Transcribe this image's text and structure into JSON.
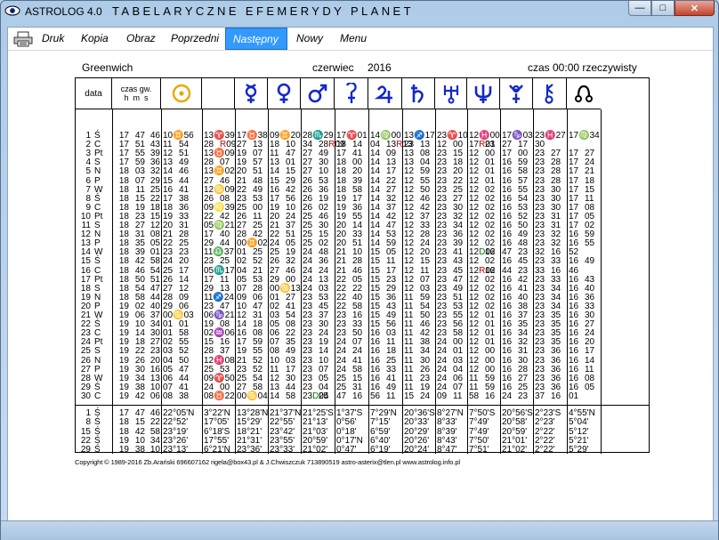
{
  "window": {
    "app_title": "ASTROLOG 4.0",
    "subtitle": "TABELARYCZNE EFEMERYDY PLANET",
    "min_glyph": "—",
    "max_glyph": "□",
    "close_glyph": "✕"
  },
  "menu": [
    "Druk",
    "Kopia",
    "Obraz",
    "Poprzedni",
    "Następny",
    "Nowy",
    "Menu"
  ],
  "menu_active": "Następny",
  "header": {
    "location": "Greenwich",
    "month": "czerwiec",
    "year": "2016",
    "time_note": "czas 00:00 rzeczywisty",
    "col_date": "data",
    "col_time_l1": "czas gw.",
    "col_time_l2": "h  m  s"
  },
  "planet_icons": [
    "sun-icon",
    "moon-icon",
    "mercury-icon",
    "venus-icon",
    "mars-icon",
    "ceres-icon",
    "jupiter-icon",
    "saturn-icon",
    "uranus-icon",
    "neptune-icon",
    "pluto-icon",
    "chiron-icon",
    "node-icon"
  ],
  "colors": {
    "accent_gold": "#e8a800",
    "moon_gold": "#f0b400",
    "planet_blue": "#1428c8",
    "retro_red": "#d00000",
    "direct_green": "#008000",
    "menu_active": "#3399ff"
  },
  "rows": [
    [
      "1",
      "Ś",
      "17",
      "47",
      "46",
      "10♊56",
      "13♈39",
      "17♉38",
      "09♊20",
      "28♏29",
      "17♈01",
      "14♍00",
      "13♐17",
      "23♈10",
      "12♓00",
      "17♑03",
      "23♓27",
      "17♍34"
    ],
    [
      "2",
      "C",
      "17",
      "51",
      "43",
      "11",
      "54",
      "28",
      "R 09",
      "27",
      "13",
      "18",
      "10",
      "34",
      "28R 09",
      "18",
      "14",
      "04",
      "13R 13",
      "23",
      "13",
      "12",
      "00",
      "17R 01",
      "23",
      "27",
      "17",
      "30"
    ],
    [
      "3",
      "Pt",
      "17",
      "55",
      "39",
      "12",
      "51",
      "13♉09",
      "19",
      "07",
      "11",
      "47",
      "27",
      "49",
      "17",
      "41",
      "14",
      "09",
      "13",
      "08",
      "23",
      "15",
      "12",
      "00",
      "17",
      "00",
      "23",
      "27",
      "17",
      "27"
    ],
    [
      "4",
      "S",
      "17",
      "59",
      "36",
      "13",
      "49",
      "28",
      "07",
      "19",
      "57",
      "13",
      "01",
      "27",
      "30",
      "18",
      "00",
      "14",
      "13",
      "13",
      "04",
      "23",
      "18",
      "12",
      "01",
      "16",
      "59",
      "23",
      "28",
      "17",
      "24"
    ],
    [
      "5",
      "N",
      "18",
      "03",
      "32",
      "14",
      "46",
      "13♊02",
      "20",
      "51",
      "14",
      "15",
      "27",
      "10",
      "18",
      "20",
      "14",
      "17",
      "12",
      "59",
      "23",
      "20",
      "12",
      "01",
      "16",
      "58",
      "23",
      "28",
      "17",
      "21"
    ],
    [
      "6",
      "P",
      "18",
      "07",
      "29",
      "15",
      "44",
      "27",
      "46",
      "21",
      "48",
      "15",
      "29",
      "26",
      "53",
      "18",
      "39",
      "14",
      "22",
      "12",
      "55",
      "23",
      "22",
      "12",
      "01",
      "16",
      "57",
      "23",
      "28",
      "17",
      "18"
    ],
    [
      "7",
      "W",
      "18",
      "11",
      "25",
      "16",
      "41",
      "12♋09",
      "22",
      "49",
      "16",
      "42",
      "26",
      "36",
      "18",
      "58",
      "14",
      "27",
      "12",
      "50",
      "23",
      "25",
      "12",
      "02",
      "16",
      "55",
      "23",
      "30",
      "17",
      "15"
    ],
    [
      "8",
      "Ś",
      "18",
      "15",
      "22",
      "17",
      "38",
      "26",
      "08",
      "23",
      "53",
      "17",
      "56",
      "26",
      "19",
      "19",
      "17",
      "14",
      "32",
      "12",
      "46",
      "23",
      "27",
      "12",
      "02",
      "16",
      "54",
      "23",
      "30",
      "17",
      "11"
    ],
    [
      "9",
      "C",
      "18",
      "19",
      "18",
      "18",
      "36",
      "09♌39",
      "25",
      "00",
      "19",
      "10",
      "26",
      "02",
      "19",
      "36",
      "14",
      "37",
      "12",
      "42",
      "23",
      "30",
      "12",
      "02",
      "16",
      "53",
      "23",
      "30",
      "17",
      "08"
    ],
    [
      "10",
      "Pt",
      "18",
      "23",
      "15",
      "19",
      "33",
      "22",
      "42",
      "26",
      "11",
      "20",
      "24",
      "25",
      "46",
      "19",
      "55",
      "14",
      "42",
      "12",
      "37",
      "23",
      "32",
      "12",
      "02",
      "16",
      "52",
      "23",
      "31",
      "17",
      "05"
    ],
    [
      "11",
      "S",
      "18",
      "27",
      "12",
      "20",
      "31",
      "05♍21",
      "27",
      "25",
      "21",
      "37",
      "25",
      "30",
      "20",
      "14",
      "14",
      "47",
      "12",
      "33",
      "23",
      "34",
      "12",
      "02",
      "16",
      "50",
      "23",
      "31",
      "17",
      "02"
    ],
    [
      "12",
      "N",
      "18",
      "31",
      "08",
      "21",
      "28",
      "17",
      "40",
      "28",
      "42",
      "22",
      "51",
      "25",
      "15",
      "20",
      "33",
      "14",
      "53",
      "12",
      "28",
      "23",
      "36",
      "12",
      "02",
      "16",
      "49",
      "23",
      "32",
      "16",
      "59"
    ],
    [
      "13",
      "P",
      "18",
      "35",
      "05",
      "22",
      "25",
      "29",
      "44",
      "00♊02",
      "24",
      "05",
      "25",
      "02",
      "20",
      "51",
      "14",
      "59",
      "12",
      "24",
      "23",
      "39",
      "12",
      "02",
      "16",
      "48",
      "23",
      "32",
      "16",
      "55"
    ],
    [
      "14",
      "W",
      "18",
      "39",
      "01",
      "23",
      "23",
      "11♎37",
      "01",
      "25",
      "25",
      "19",
      "24",
      "48",
      "21",
      "10",
      "15",
      "05",
      "12",
      "20",
      "23",
      "41",
      "12D 02",
      "16",
      "47",
      "23",
      "32",
      "16",
      "52"
    ],
    [
      "15",
      "Ś",
      "18",
      "42",
      "58",
      "24",
      "20",
      "23",
      "25",
      "02",
      "52",
      "26",
      "32",
      "24",
      "36",
      "21",
      "28",
      "15",
      "11",
      "12",
      "15",
      "23",
      "43",
      "12",
      "02",
      "16",
      "45",
      "23",
      "33",
      "16",
      "49"
    ],
    [
      "16",
      "C",
      "18",
      "46",
      "54",
      "25",
      "17",
      "05♏17",
      "04",
      "21",
      "27",
      "46",
      "24",
      "24",
      "21",
      "46",
      "15",
      "17",
      "12",
      "11",
      "23",
      "45",
      "12R 02",
      "16",
      "44",
      "23",
      "33",
      "16",
      "46"
    ],
    [
      "17",
      "Pt",
      "18",
      "50",
      "51",
      "26",
      "14",
      "17",
      "11",
      "05",
      "53",
      "29",
      "00",
      "24",
      "13",
      "22",
      "05",
      "15",
      "23",
      "12",
      "07",
      "23",
      "47",
      "12",
      "02",
      "16",
      "42",
      "23",
      "33",
      "16",
      "43"
    ],
    [
      "18",
      "S",
      "18",
      "54",
      "47",
      "27",
      "12",
      "29",
      "13",
      "07",
      "28",
      "00♋13",
      "24",
      "03",
      "22",
      "22",
      "15",
      "29",
      "12",
      "03",
      "23",
      "49",
      "12",
      "02",
      "16",
      "41",
      "23",
      "34",
      "16",
      "40"
    ],
    [
      "19",
      "N",
      "18",
      "58",
      "44",
      "28",
      "09",
      "11♐24",
      "09",
      "06",
      "01",
      "27",
      "23",
      "53",
      "22",
      "40",
      "15",
      "36",
      "11",
      "59",
      "23",
      "51",
      "12",
      "02",
      "16",
      "40",
      "23",
      "34",
      "16",
      "36"
    ],
    [
      "20",
      "P",
      "19",
      "02",
      "40",
      "29",
      "06",
      "23",
      "47",
      "10",
      "47",
      "02",
      "41",
      "23",
      "45",
      "22",
      "58",
      "15",
      "43",
      "11",
      "54",
      "23",
      "53",
      "12",
      "02",
      "16",
      "38",
      "23",
      "34",
      "16",
      "33"
    ],
    [
      "21",
      "W",
      "19",
      "06",
      "37",
      "00♋03",
      "06♑21",
      "12",
      "31",
      "03",
      "54",
      "23",
      "37",
      "23",
      "16",
      "15",
      "49",
      "11",
      "50",
      "23",
      "55",
      "12",
      "01",
      "16",
      "37",
      "23",
      "35",
      "16",
      "30"
    ],
    [
      "22",
      "Ś",
      "19",
      "10",
      "34",
      "01",
      "01",
      "19",
      "08",
      "14",
      "18",
      "05",
      "08",
      "23",
      "30",
      "23",
      "33",
      "15",
      "56",
      "11",
      "46",
      "23",
      "56",
      "12",
      "01",
      "16",
      "35",
      "23",
      "35",
      "16",
      "27"
    ],
    [
      "23",
      "C",
      "19",
      "14",
      "30",
      "01",
      "58",
      "02♒06",
      "16",
      "08",
      "06",
      "22",
      "23",
      "24",
      "23",
      "50",
      "16",
      "03",
      "11",
      "42",
      "23",
      "58",
      "12",
      "01",
      "16",
      "34",
      "23",
      "35",
      "16",
      "24"
    ],
    [
      "24",
      "Pt",
      "19",
      "18",
      "27",
      "02",
      "55",
      "15",
      "16",
      "17",
      "59",
      "07",
      "35",
      "23",
      "19",
      "24",
      "07",
      "16",
      "11",
      "11",
      "38",
      "24",
      "00",
      "12",
      "01",
      "16",
      "32",
      "23",
      "35",
      "16",
      "20"
    ],
    [
      "25",
      "S",
      "19",
      "22",
      "23",
      "03",
      "52",
      "28",
      "37",
      "19",
      "55",
      "08",
      "49",
      "23",
      "14",
      "24",
      "24",
      "16",
      "18",
      "11",
      "34",
      "24",
      "01",
      "12",
      "00",
      "16",
      "31",
      "23",
      "36",
      "16",
      "17"
    ],
    [
      "26",
      "N",
      "19",
      "26",
      "20",
      "04",
      "50",
      "12♓08",
      "21",
      "52",
      "10",
      "03",
      "23",
      "10",
      "24",
      "41",
      "16",
      "25",
      "11",
      "30",
      "24",
      "03",
      "12",
      "00",
      "16",
      "30",
      "23",
      "36",
      "16",
      "14"
    ],
    [
      "27",
      "P",
      "19",
      "30",
      "16",
      "05",
      "47",
      "25",
      "53",
      "23",
      "52",
      "11",
      "17",
      "23",
      "07",
      "24",
      "58",
      "16",
      "33",
      "11",
      "26",
      "24",
      "04",
      "12",
      "00",
      "16",
      "28",
      "23",
      "36",
      "16",
      "11"
    ],
    [
      "28",
      "W",
      "19",
      "34",
      "13",
      "06",
      "44",
      "09♈50",
      "25",
      "54",
      "12",
      "30",
      "23",
      "05",
      "25",
      "15",
      "16",
      "41",
      "11",
      "23",
      "24",
      "06",
      "11",
      "59",
      "16",
      "27",
      "23",
      "36",
      "16",
      "08"
    ],
    [
      "29",
      "Ś",
      "19",
      "38",
      "10",
      "07",
      "41",
      "24",
      "00",
      "27",
      "58",
      "13",
      "44",
      "23",
      "04",
      "25",
      "31",
      "16",
      "49",
      "11",
      "19",
      "24",
      "07",
      "11",
      "59",
      "16",
      "25",
      "23",
      "36",
      "16",
      "05"
    ],
    [
      "30",
      "C",
      "19",
      "42",
      "06",
      "08",
      "38",
      "08♉22",
      "00♋04",
      "14",
      "58",
      "23D 04",
      "25",
      "47",
      "16",
      "56",
      "11",
      "15",
      "24",
      "09",
      "11",
      "58",
      "16",
      "24",
      "23",
      "37",
      "16",
      "01"
    ]
  ],
  "summary": [
    [
      "1",
      "Ś",
      "17",
      "47",
      "46",
      "22°05'N",
      "3°22'N",
      "13°28'N",
      "21°37'N",
      "21°25'S",
      "1°37'S",
      "7°29'N",
      "20°36'S",
      "8°27'N",
      "7°50'S",
      "20°56'S",
      "2°23'S",
      "4°55'N"
    ],
    [
      "8",
      "Ś",
      "18",
      "15",
      "22",
      "22°52'",
      "17°05'",
      "15°29'",
      "22°55'",
      "21°13'",
      "0°56'",
      "7°15'",
      "20°33'",
      "8°33'",
      "7°49'",
      "20°58'",
      "2°23'",
      "5°04'"
    ],
    [
      "15",
      "Ś",
      "18",
      "42",
      "58",
      "23°19'",
      "6°18'S",
      "18°21'",
      "23°42'",
      "21°03'",
      "0°18'",
      "6°59'",
      "20°29'",
      "8°39'",
      "7°49'",
      "20°59'",
      "2°22'",
      "5°12'"
    ],
    [
      "22",
      "Ś",
      "19",
      "10",
      "34",
      "23°26'",
      "17°55'",
      "21°31'",
      "23°55'",
      "20°59'",
      "0°17'N",
      "6°40'",
      "20°26'",
      "8°43'",
      "7°50'",
      "21°01'",
      "2°22'",
      "5°21'"
    ],
    [
      "29",
      "Ś",
      "19",
      "38",
      "10",
      "23°13'",
      "6°21'N",
      "23°36'",
      "23°33'",
      "21°02'",
      "0°47'",
      "6°19'",
      "20°24'",
      "8°47'",
      "7°51'",
      "21°02'",
      "2°22'",
      "5°29'"
    ]
  ],
  "copyright": "Copyright © 1989-2016 Zb.Arański 696607162 rigela@box43.pl & J.Chwiszczuk 713890519 astro-asterix@tlen.pl www.astrolog.info.pl"
}
